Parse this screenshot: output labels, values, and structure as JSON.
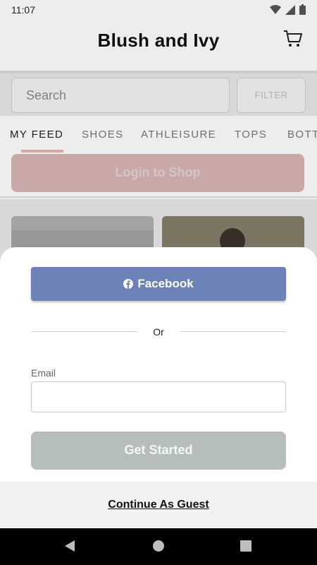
{
  "status_bar": {
    "time": "11:07"
  },
  "header": {
    "title": "Blush and Ivy",
    "cart_icon": "cart-icon"
  },
  "search": {
    "placeholder": "Search",
    "filter_label": "FILTER"
  },
  "tabs": [
    {
      "label": "MY FEED",
      "active": true
    },
    {
      "label": "SHOES"
    },
    {
      "label": "ATHLEISURE"
    },
    {
      "label": "TOPS"
    },
    {
      "label": "BOTT"
    }
  ],
  "login_shop": {
    "label": "Login to Shop"
  },
  "sheet": {
    "facebook_label": "Facebook",
    "or_text": "Or",
    "email_label": "Email",
    "email_value": "",
    "get_started_label": "Get Started",
    "continue_guest_label": "Continue As Guest"
  },
  "colors": {
    "facebook": "#6d83b7",
    "get_started": "#b6bdbd",
    "login_shop": "#d9b5b5",
    "tab_underline": "#e8b7b7"
  }
}
